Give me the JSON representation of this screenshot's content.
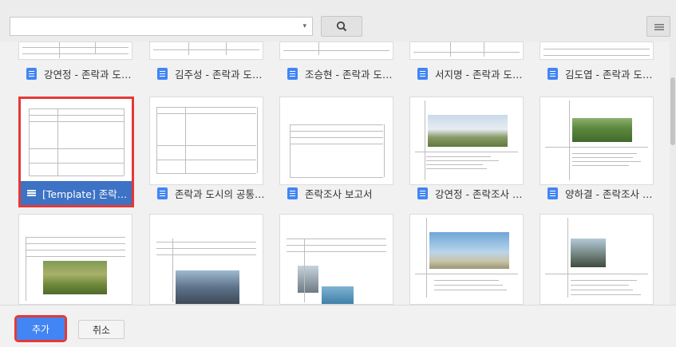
{
  "toolbar": {
    "select_value": "",
    "select_caret": "▾",
    "search_icon": "search-icon",
    "view_icon": "list-view-icon"
  },
  "row1": [
    {
      "title": "강연정 - 존락과 도시..."
    },
    {
      "title": "김주성 - 존락과 도시..."
    },
    {
      "title": "조승현 - 존락과 도시..."
    },
    {
      "title": "서지명 - 존락과 도시..."
    },
    {
      "title": "김도엽 - 존락과 도시..."
    }
  ],
  "row2": [
    {
      "title": "[Template] 존락과 도...",
      "selected": true
    },
    {
      "title": "존락과 도시의 공통점..."
    },
    {
      "title": "존락조사 보고서"
    },
    {
      "title": "강연정 - 존락조사 보..."
    },
    {
      "title": "양하결 - 존락조사 보..."
    }
  ],
  "buttons": {
    "add": "추가",
    "cancel": "취소"
  },
  "colors": {
    "selected_bar": "#3d72c4",
    "highlight": "#e53935",
    "doc_icon": "#4285f4",
    "add_button": "#4285f4"
  }
}
